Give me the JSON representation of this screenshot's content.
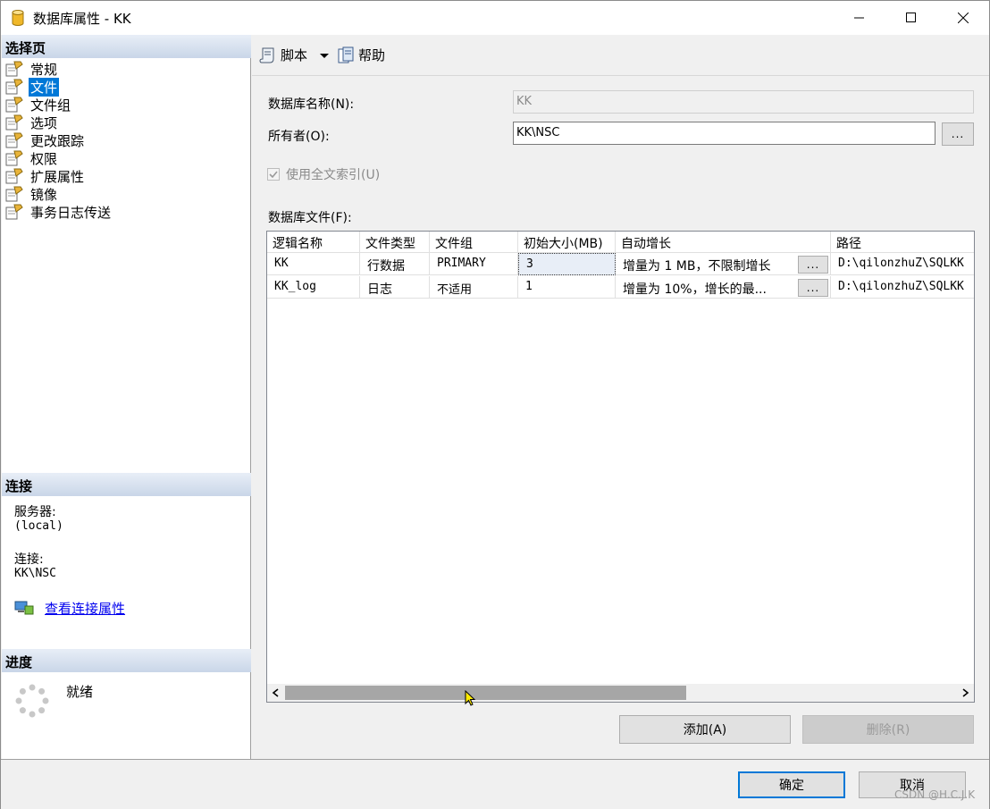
{
  "window": {
    "title": "数据库属性 - KK"
  },
  "left": {
    "select_page_header": "选择页",
    "nav_items": [
      {
        "label": "常规"
      },
      {
        "label": "文件"
      },
      {
        "label": "文件组"
      },
      {
        "label": "选项"
      },
      {
        "label": "更改跟踪"
      },
      {
        "label": "权限"
      },
      {
        "label": "扩展属性"
      },
      {
        "label": "镜像"
      },
      {
        "label": "事务日志传送"
      }
    ],
    "selected_index": 1,
    "connection_header": "连接",
    "server_label": "服务器:",
    "server_value": "(local)",
    "connection_label": "连接:",
    "connection_value": "KK\\NSC",
    "view_conn_link": "查看连接属性",
    "progress_header": "进度",
    "progress_status": "就绪"
  },
  "toolbar": {
    "script_label": "脚本",
    "help_label": "帮助"
  },
  "form": {
    "db_name_label": "数据库名称(N):",
    "db_name_value": "KK",
    "owner_label": "所有者(O):",
    "owner_value": "KK\\NSC",
    "owner_browse": "...",
    "fulltext_label": "使用全文索引(U)",
    "fulltext_checked": true,
    "files_label": "数据库文件(F):"
  },
  "grid": {
    "columns": [
      "逻辑名称",
      "文件类型",
      "文件组",
      "初始大小(MB)",
      "自动增长",
      "路径"
    ],
    "rows": [
      {
        "name": "KK",
        "type": "行数据",
        "filegroup": "PRIMARY",
        "size": "3",
        "growth": "增量为 1 MB，不限制增长",
        "path": "D:\\qilonzhuZ\\SQLKK"
      },
      {
        "name": "KK_log",
        "type": "日志",
        "filegroup": "不适用",
        "size": "1",
        "growth": "增量为 10%，增长的最...",
        "path": "D:\\qilonzhuZ\\SQLKK"
      }
    ],
    "cell_button": "..."
  },
  "actions": {
    "add_label": "添加(A)",
    "remove_label": "删除(R)"
  },
  "footer": {
    "ok_label": "确定",
    "cancel_label": "取消",
    "watermark": "CSDN @H.C.J.K"
  }
}
